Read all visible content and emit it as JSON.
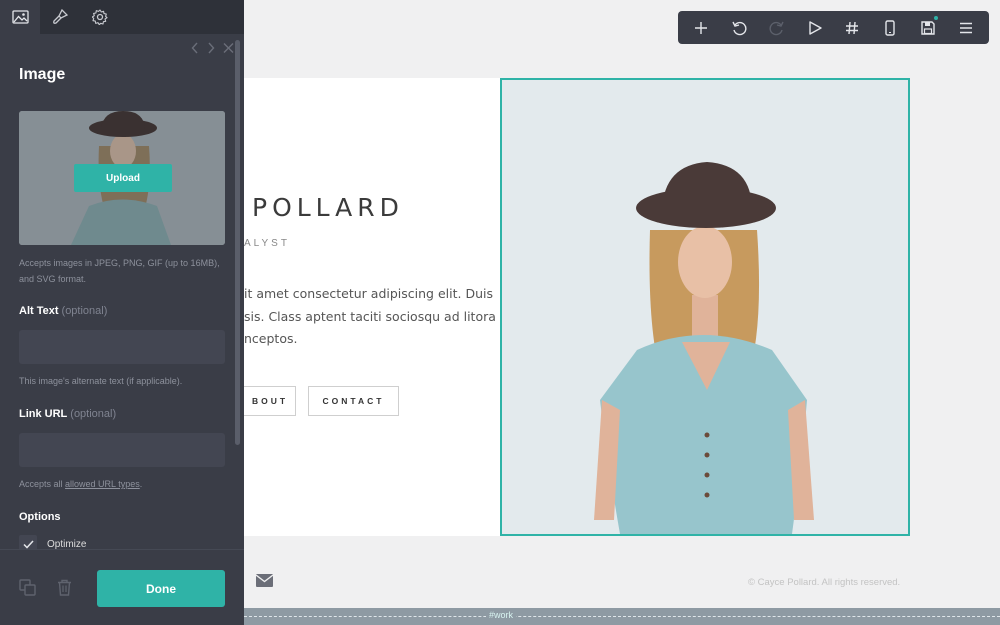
{
  "toolbar": {
    "buttons": [
      {
        "name": "add-icon"
      },
      {
        "name": "undo-icon"
      },
      {
        "name": "redo-icon"
      },
      {
        "name": "play-icon"
      },
      {
        "name": "hash-icon"
      },
      {
        "name": "mobile-icon"
      },
      {
        "name": "save-icon"
      },
      {
        "name": "menu-icon"
      }
    ],
    "accent_color": "#2fb3a7"
  },
  "panel": {
    "tabs": [
      {
        "name": "image-tab-icon",
        "active": true
      },
      {
        "name": "brush-tab-icon",
        "active": false
      },
      {
        "name": "settings-tab-icon",
        "active": false
      }
    ],
    "title": "Image",
    "upload_label": "Upload",
    "upload_help": "Accepts images in JPEG, PNG, GIF (up to 16MB), and SVG format.",
    "alt_text": {
      "label": "Alt Text",
      "optional": "(optional)",
      "value": "",
      "help": "This image's alternate text (if applicable)."
    },
    "link_url": {
      "label": "Link URL",
      "optional": "(optional)",
      "value": "",
      "help_prefix": "Accepts all ",
      "help_link": "allowed URL types",
      "help_suffix": "."
    },
    "options": {
      "label": "Options",
      "items": [
        {
          "label": "Optimize",
          "checked": true
        }
      ]
    },
    "done_label": "Done"
  },
  "page": {
    "name": "POLLARD",
    "role": "ALYST",
    "paragraph_lines": [
      "it amet consectetur adipiscing elit. Duis",
      "sis. Class aptent taciti sociosqu ad litora",
      "nceptos."
    ],
    "buttons": {
      "about": "BOUT",
      "contact": "CONTACT"
    },
    "footer_copyright": "© Cayce Pollard. All rights reserved.",
    "section_label": "#work"
  }
}
